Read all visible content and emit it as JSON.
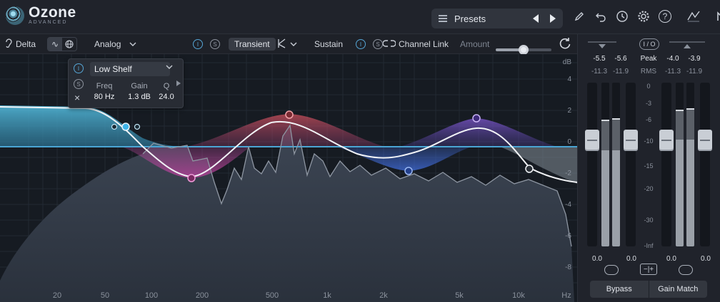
{
  "app": {
    "name": "Ozone",
    "edition": "ADVANCED"
  },
  "presets": {
    "label": "Presets",
    "prev_icon": "triangle-left",
    "next_icon": "triangle-right"
  },
  "toolbar_icons": [
    "pencil-icon",
    "undo-icon",
    "history-icon",
    "gear-icon",
    "help-icon",
    "signal-chain-icon",
    "native-instruments-icon"
  ],
  "help_label": "?",
  "module_bar": {
    "delta_label": "Delta",
    "mode_label": "Analog",
    "transient_label": "Transient",
    "sustain_label": "Sustain",
    "channel_link_label": "Channel Link",
    "amount_label": "Amount",
    "solo_label": "S",
    "info_label": "I",
    "amount_value": 0.5
  },
  "band_popup": {
    "shape": "Low Shelf",
    "freq_label": "Freq",
    "freq_value": "80 Hz",
    "gain_label": "Gain",
    "gain_value": "1.3 dB",
    "q_label": "Q",
    "q_value": "24.0",
    "info_label": "I",
    "solo_label": "S",
    "close_label": "×"
  },
  "graph": {
    "db_unit": "dB",
    "db_ticks": [
      "4",
      "2",
      "0",
      "-2",
      "-4",
      "-6",
      "-8"
    ],
    "hz_unit": "Hz",
    "freq_ticks": [
      "20",
      "50",
      "100",
      "200",
      "500",
      "1k",
      "2k",
      "5k",
      "10k"
    ]
  },
  "meters": {
    "in_peak": [
      "-5.5",
      "-5.6"
    ],
    "in_rms": [
      "-11.3",
      "-11.9"
    ],
    "out_peak": [
      "-4.0",
      "-3.9"
    ],
    "out_rms": [
      "-11.3",
      "-11.9"
    ],
    "peak_label": "Peak",
    "rms_label": "RMS",
    "io_label": "I / O",
    "scale": [
      "0",
      "-3",
      "-6",
      "-10",
      "-15",
      "-20",
      "-30",
      "-Inf"
    ],
    "in_gain": [
      "0.0",
      "0.0"
    ],
    "out_gain": [
      "0.0",
      "0.0"
    ],
    "bypass_label": "Bypass",
    "gain_match_label": "Gain Match"
  }
}
